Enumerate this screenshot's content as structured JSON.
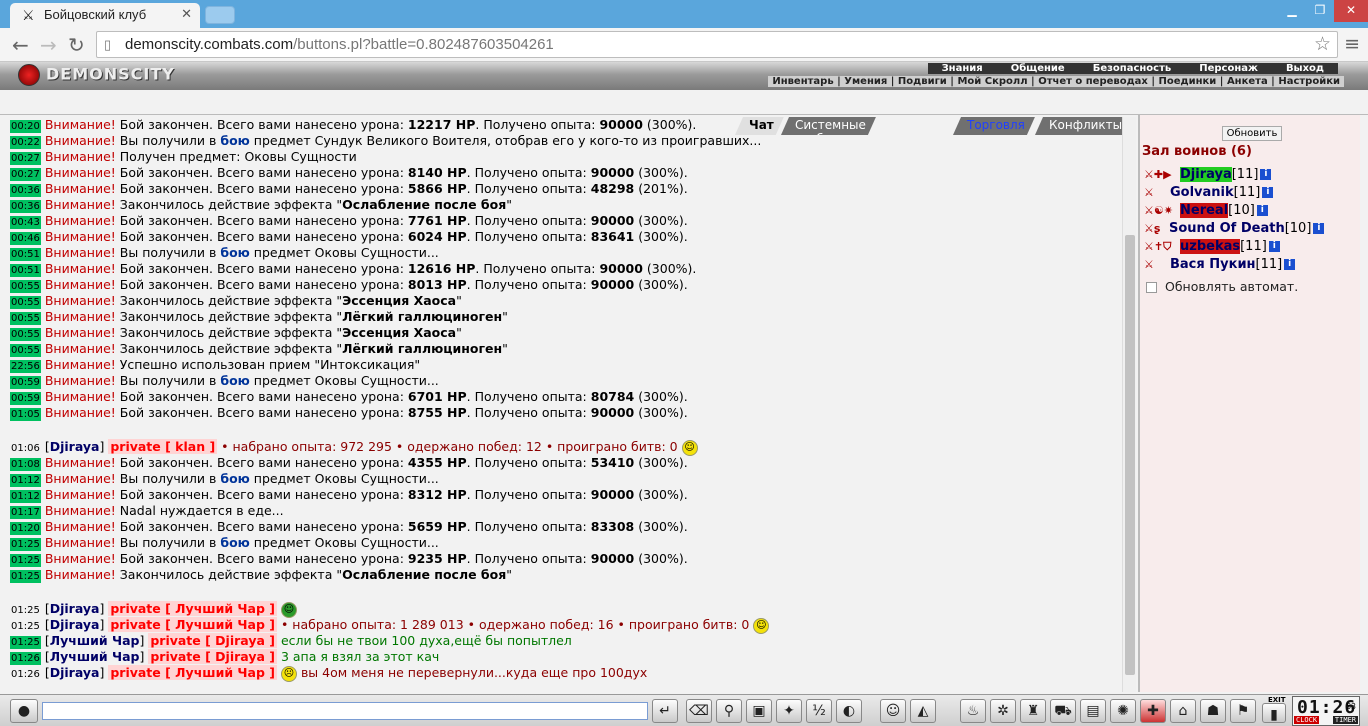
{
  "browser": {
    "tab_title": "Бойцовский клуб",
    "url_host": "demonscity.combats.com",
    "url_path": "/buttons.pl?battle=0.802487603504261"
  },
  "site": {
    "logo": "DEMONSCITY",
    "top_menu": [
      "Знания",
      "Общение",
      "Безопасность",
      "Персонаж",
      "Выход"
    ],
    "sub_menu": [
      "Инвентарь",
      "Умения",
      "Подвиги",
      "Мой Скролл",
      "Отчет о переводах",
      "Поединки",
      "Анкета",
      "Настройки"
    ]
  },
  "chat_tabs": [
    "Чат",
    "Системные сообщения",
    "Торговля",
    "Конфликты"
  ],
  "chat": {
    "warn": "Внимание!",
    "lines": [
      {
        "t": "00:20",
        "seg": [
          [
            "w",
            "Внимание!"
          ],
          [
            "n",
            " Бой закончен. Всего вами нанесено урона: "
          ],
          [
            "b",
            "12217 HP"
          ],
          [
            "n",
            ". Получено опыта: "
          ],
          [
            "b",
            "90000"
          ],
          [
            "n",
            " (300%)."
          ]
        ]
      },
      {
        "t": "00:22",
        "seg": [
          [
            "w",
            "Внимание!"
          ],
          [
            "n",
            " Вы получили в "
          ],
          [
            "bl",
            "бою"
          ],
          [
            "n",
            " предмет Сундук Великого Воителя, отобрав его у кого-то из проигравших..."
          ]
        ]
      },
      {
        "t": "00:27",
        "seg": [
          [
            "w",
            "Внимание!"
          ],
          [
            "n",
            " Получен предмет: Оковы Сущности"
          ]
        ]
      },
      {
        "t": "00:27",
        "seg": [
          [
            "w",
            "Внимание!"
          ],
          [
            "n",
            " Бой закончен. Всего вами нанесено урона: "
          ],
          [
            "b",
            "8140 HP"
          ],
          [
            "n",
            ". Получено опыта: "
          ],
          [
            "b",
            "90000"
          ],
          [
            "n",
            " (300%)."
          ]
        ]
      },
      {
        "t": "00:36",
        "seg": [
          [
            "w",
            "Внимание!"
          ],
          [
            "n",
            " Бой закончен. Всего вами нанесено урона: "
          ],
          [
            "b",
            "5866 HP"
          ],
          [
            "n",
            ". Получено опыта: "
          ],
          [
            "b",
            "48298"
          ],
          [
            "n",
            " (201%)."
          ]
        ]
      },
      {
        "t": "00:36",
        "seg": [
          [
            "w",
            "Внимание!"
          ],
          [
            "n",
            " Закончилось действие эффекта \""
          ],
          [
            "b",
            "Ослабление после боя"
          ],
          [
            "n",
            "\""
          ]
        ]
      },
      {
        "t": "00:43",
        "seg": [
          [
            "w",
            "Внимание!"
          ],
          [
            "n",
            " Бой закончен. Всего вами нанесено урона: "
          ],
          [
            "b",
            "7761 HP"
          ],
          [
            "n",
            ". Получено опыта: "
          ],
          [
            "b",
            "90000"
          ],
          [
            "n",
            " (300%)."
          ]
        ]
      },
      {
        "t": "00:46",
        "seg": [
          [
            "w",
            "Внимание!"
          ],
          [
            "n",
            " Бой закончен. Всего вами нанесено урона: "
          ],
          [
            "b",
            "6024 HP"
          ],
          [
            "n",
            ". Получено опыта: "
          ],
          [
            "b",
            "83641"
          ],
          [
            "n",
            " (300%)."
          ]
        ]
      },
      {
        "t": "00:51",
        "seg": [
          [
            "w",
            "Внимание!"
          ],
          [
            "n",
            " Вы получили в "
          ],
          [
            "bl",
            "бою"
          ],
          [
            "n",
            " предмет Оковы Сущности..."
          ]
        ]
      },
      {
        "t": "00:51",
        "seg": [
          [
            "w",
            "Внимание!"
          ],
          [
            "n",
            " Бой закончен. Всего вами нанесено урона: "
          ],
          [
            "b",
            "12616 HP"
          ],
          [
            "n",
            ". Получено опыта: "
          ],
          [
            "b",
            "90000"
          ],
          [
            "n",
            " (300%)."
          ]
        ]
      },
      {
        "t": "00:55",
        "seg": [
          [
            "w",
            "Внимание!"
          ],
          [
            "n",
            " Бой закончен. Всего вами нанесено урона: "
          ],
          [
            "b",
            "8013 HP"
          ],
          [
            "n",
            ". Получено опыта: "
          ],
          [
            "b",
            "90000"
          ],
          [
            "n",
            " (300%)."
          ]
        ]
      },
      {
        "t": "00:55",
        "seg": [
          [
            "w",
            "Внимание!"
          ],
          [
            "n",
            " Закончилось действие эффекта \""
          ],
          [
            "b",
            "Эссенция Хаоса"
          ],
          [
            "n",
            "\""
          ]
        ]
      },
      {
        "t": "00:55",
        "seg": [
          [
            "w",
            "Внимание!"
          ],
          [
            "n",
            " Закончилось действие эффекта \""
          ],
          [
            "b",
            "Лёгкий галлюциноген"
          ],
          [
            "n",
            "\""
          ]
        ]
      },
      {
        "t": "00:55",
        "seg": [
          [
            "w",
            "Внимание!"
          ],
          [
            "n",
            " Закончилось действие эффекта \""
          ],
          [
            "b",
            "Эссенция Хаоса"
          ],
          [
            "n",
            "\""
          ]
        ]
      },
      {
        "t": "00:55",
        "seg": [
          [
            "w",
            "Внимание!"
          ],
          [
            "n",
            " Закончилось действие эффекта \""
          ],
          [
            "b",
            "Лёгкий галлюциноген"
          ],
          [
            "n",
            "\""
          ]
        ]
      },
      {
        "t": "22:56",
        "seg": [
          [
            "w",
            "Внимание!"
          ],
          [
            "n",
            " Успешно использован прием \"Интоксикация\""
          ]
        ]
      },
      {
        "t": "00:59",
        "seg": [
          [
            "w",
            "Внимание!"
          ],
          [
            "n",
            " Вы получили в "
          ],
          [
            "bl",
            "бою"
          ],
          [
            "n",
            " предмет Оковы Сущности..."
          ]
        ]
      },
      {
        "t": "00:59",
        "seg": [
          [
            "w",
            "Внимание!"
          ],
          [
            "n",
            " Бой закончен. Всего вами нанесено урона: "
          ],
          [
            "b",
            "6701 HP"
          ],
          [
            "n",
            ". Получено опыта: "
          ],
          [
            "b",
            "80784"
          ],
          [
            "n",
            " (300%)."
          ]
        ]
      },
      {
        "t": "01:05",
        "seg": [
          [
            "w",
            "Внимание!"
          ],
          [
            "n",
            " Бой закончен. Всего вами нанесено урона: "
          ],
          [
            "b",
            "8755 HP"
          ],
          [
            "n",
            ". Получено опыта: "
          ],
          [
            "b",
            "90000"
          ],
          [
            "n",
            " (300%)."
          ]
        ]
      },
      {
        "gap": true
      },
      {
        "t": "01:06",
        "plain": true,
        "seg": [
          [
            "n",
            "["
          ],
          [
            "nk",
            "Djiraya"
          ],
          [
            "n",
            "] "
          ],
          [
            "pr",
            "private [ klan ]"
          ],
          [
            "dr",
            " • набрано опыта: 972 295 • одержано побед: 12 • проиграно битв: 0 "
          ],
          [
            "smile",
            "☺"
          ]
        ]
      },
      {
        "t": "01:08",
        "seg": [
          [
            "w",
            "Внимание!"
          ],
          [
            "n",
            " Бой закончен. Всего вами нанесено урона: "
          ],
          [
            "b",
            "4355 HP"
          ],
          [
            "n",
            ". Получено опыта: "
          ],
          [
            "b",
            "53410"
          ],
          [
            "n",
            " (300%)."
          ]
        ]
      },
      {
        "t": "01:12",
        "seg": [
          [
            "w",
            "Внимание!"
          ],
          [
            "n",
            " Вы получили в "
          ],
          [
            "bl",
            "бою"
          ],
          [
            "n",
            " предмет Оковы Сущности..."
          ]
        ]
      },
      {
        "t": "01:12",
        "seg": [
          [
            "w",
            "Внимание!"
          ],
          [
            "n",
            " Бой закончен. Всего вами нанесено урона: "
          ],
          [
            "b",
            "8312 HP"
          ],
          [
            "n",
            ". Получено опыта: "
          ],
          [
            "b",
            "90000"
          ],
          [
            "n",
            " (300%)."
          ]
        ]
      },
      {
        "t": "01:17",
        "seg": [
          [
            "w",
            "Внимание!"
          ],
          [
            "n",
            " Nadal нуждается в еде..."
          ]
        ]
      },
      {
        "t": "01:20",
        "seg": [
          [
            "w",
            "Внимание!"
          ],
          [
            "n",
            " Бой закончен. Всего вами нанесено урона: "
          ],
          [
            "b",
            "5659 HP"
          ],
          [
            "n",
            ". Получено опыта: "
          ],
          [
            "b",
            "83308"
          ],
          [
            "n",
            " (300%)."
          ]
        ]
      },
      {
        "t": "01:25",
        "seg": [
          [
            "w",
            "Внимание!"
          ],
          [
            "n",
            " Вы получили в "
          ],
          [
            "bl",
            "бою"
          ],
          [
            "n",
            " предмет Оковы Сущности..."
          ]
        ]
      },
      {
        "t": "01:25",
        "seg": [
          [
            "w",
            "Внимание!"
          ],
          [
            "n",
            " Бой закончен. Всего вами нанесено урона: "
          ],
          [
            "b",
            "9235 HP"
          ],
          [
            "n",
            ". Получено опыта: "
          ],
          [
            "b",
            "90000"
          ],
          [
            "n",
            " (300%)."
          ]
        ]
      },
      {
        "t": "01:25",
        "seg": [
          [
            "w",
            "Внимание!"
          ],
          [
            "n",
            " Закончилось действие эффекта \""
          ],
          [
            "b",
            "Ослабление после боя"
          ],
          [
            "n",
            "\""
          ]
        ]
      },
      {
        "gap": true
      },
      {
        "t": "01:25",
        "plain": true,
        "seg": [
          [
            "n",
            "["
          ],
          [
            "nk",
            "Djiraya"
          ],
          [
            "n",
            "] "
          ],
          [
            "pr",
            "private [ Лучший Чар ]"
          ],
          [
            "n",
            " "
          ],
          [
            "gsmile",
            "☺"
          ]
        ]
      },
      {
        "t": "01:25",
        "plain": true,
        "seg": [
          [
            "n",
            "["
          ],
          [
            "nk",
            "Djiraya"
          ],
          [
            "n",
            "] "
          ],
          [
            "pr",
            "private [ Лучший Чар ]"
          ],
          [
            "dr",
            " • набрано опыта: 1 289 013 • одержано побед: 16 • проиграно битв: 0 "
          ],
          [
            "smile",
            "☺"
          ]
        ]
      },
      {
        "t": "01:25",
        "seg": [
          [
            "n",
            "["
          ],
          [
            "nk",
            "Лучший Чар"
          ],
          [
            "n",
            "] "
          ],
          [
            "pr",
            "private [ Djiraya ]"
          ],
          [
            "gr",
            " если бы не твои 100 духа,ещё бы попытлел"
          ]
        ]
      },
      {
        "t": "01:26",
        "seg": [
          [
            "n",
            "["
          ],
          [
            "nk",
            "Лучший Чар"
          ],
          [
            "n",
            "] "
          ],
          [
            "pr",
            "private [ Djiraya ]"
          ],
          [
            "gr",
            " 3 апа я взял за этот кач"
          ]
        ]
      },
      {
        "t": "01:26",
        "plain": true,
        "seg": [
          [
            "n",
            "["
          ],
          [
            "nk",
            "Djiraya"
          ],
          [
            "n",
            "] "
          ],
          [
            "pr",
            "private [ Лучший Чар ]"
          ],
          [
            "n",
            " "
          ],
          [
            "smile",
            "☹"
          ],
          [
            "dr",
            "  вы 4ом меня не перевернули...куда еще про 100дух"
          ]
        ]
      }
    ]
  },
  "right_panel": {
    "refresh_label": "Обновить",
    "hall_title": "Зал воинов (6)",
    "users": [
      {
        "name": "Djiraya",
        "level": "[11]",
        "hl": "g",
        "icons": "⚔✚▶"
      },
      {
        "name": "Golvanik",
        "level": "[11]",
        "hl": "",
        "icons": "⚔"
      },
      {
        "name": "Nereal",
        "level": "[10]",
        "hl": "r",
        "icons": "⚔☯✷"
      },
      {
        "name": "Sound Of Death",
        "level": "[10]",
        "hl": "",
        "icons": "⚔ʂ"
      },
      {
        "name": "uzbekas",
        "level": "[11]",
        "hl": "r",
        "icons": "⚔✝⛉"
      },
      {
        "name": "Вася Пукин",
        "level": "[11]",
        "hl": "",
        "icons": "⚔"
      }
    ],
    "auto_refresh_label": "Обновлять автомат."
  },
  "clock": {
    "time": "01:26",
    "sec": "53",
    "clock_label": "CLOCK",
    "timer_label": "TIMER",
    "exit_label": "EXIT"
  }
}
